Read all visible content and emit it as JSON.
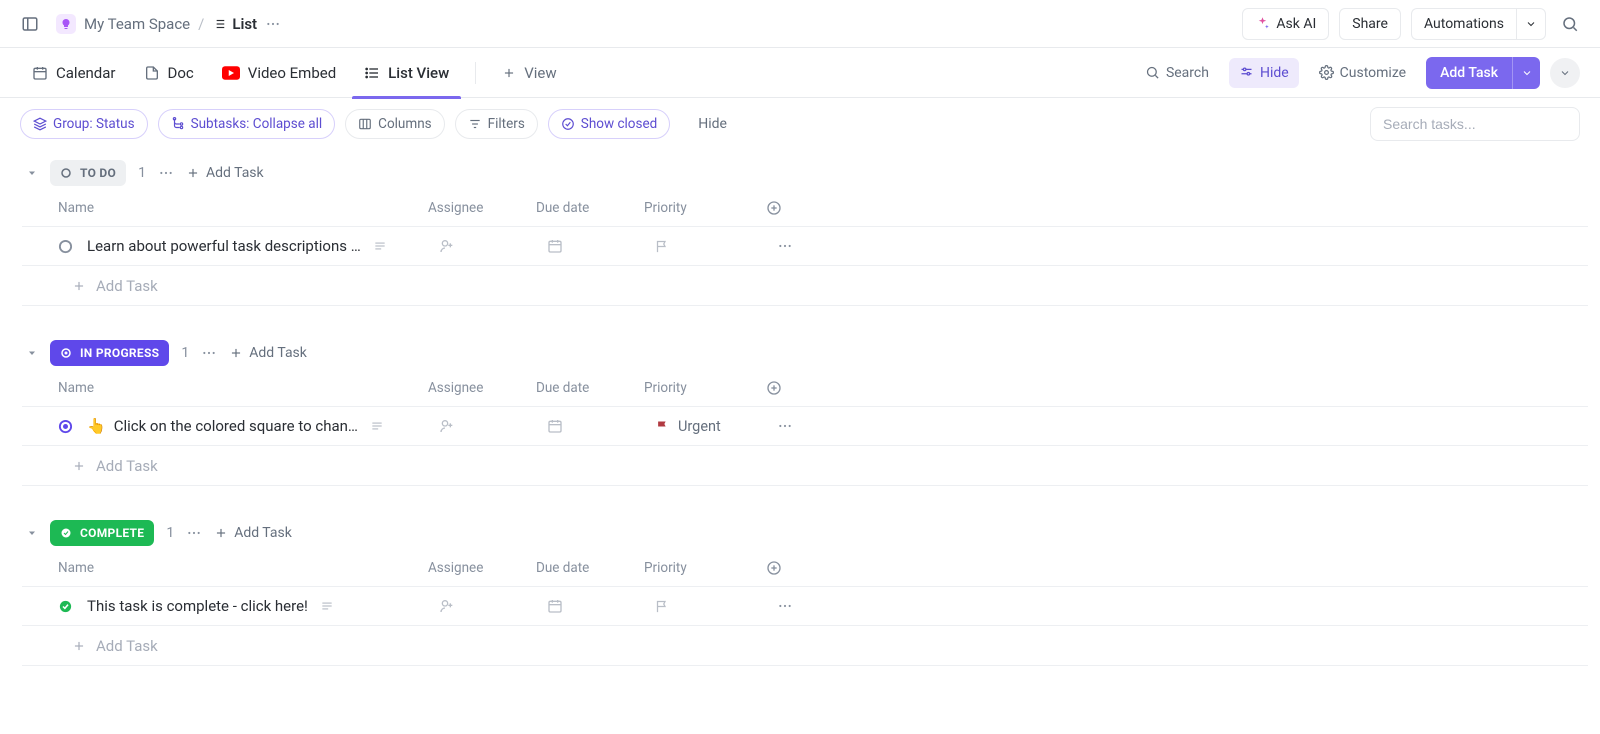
{
  "breadcrumb": {
    "space": "My Team Space",
    "current": "List"
  },
  "topbar": {
    "ask_ai": "Ask AI",
    "share": "Share",
    "automations": "Automations"
  },
  "views": {
    "calendar": "Calendar",
    "doc": "Doc",
    "video": "Video Embed",
    "listview": "List View",
    "add_view": "View"
  },
  "viewsbar_right": {
    "search": "Search",
    "hide": "Hide",
    "customize": "Customize",
    "add_task": "Add Task"
  },
  "filters": {
    "group": "Group: Status",
    "subtasks": "Subtasks: Collapse all",
    "columns": "Columns",
    "filters": "Filters",
    "show_closed": "Show closed",
    "hide": "Hide",
    "search_placeholder": "Search tasks..."
  },
  "columns": {
    "name": "Name",
    "assignee": "Assignee",
    "due": "Due date",
    "priority": "Priority"
  },
  "add_task_label": "Add Task",
  "groups": [
    {
      "key": "todo",
      "label": "TO DO",
      "count": "1",
      "tasks": [
        {
          "name": "Learn about powerful task descriptions …",
          "has_desc": true,
          "priority": "",
          "status_color": "#87909e"
        }
      ]
    },
    {
      "key": "inprogress",
      "label": "IN PROGRESS",
      "count": "1",
      "tasks": [
        {
          "emoji": "👆",
          "name": "Click on the colored square to chan…",
          "has_desc": true,
          "priority": "Urgent",
          "status_color": "#5f48ea"
        }
      ]
    },
    {
      "key": "complete",
      "label": "COMPLETE",
      "count": "1",
      "tasks": [
        {
          "name": "This task is complete - click here!",
          "has_desc": true,
          "priority": "",
          "status_color": "#1db954",
          "complete": true
        }
      ]
    }
  ]
}
